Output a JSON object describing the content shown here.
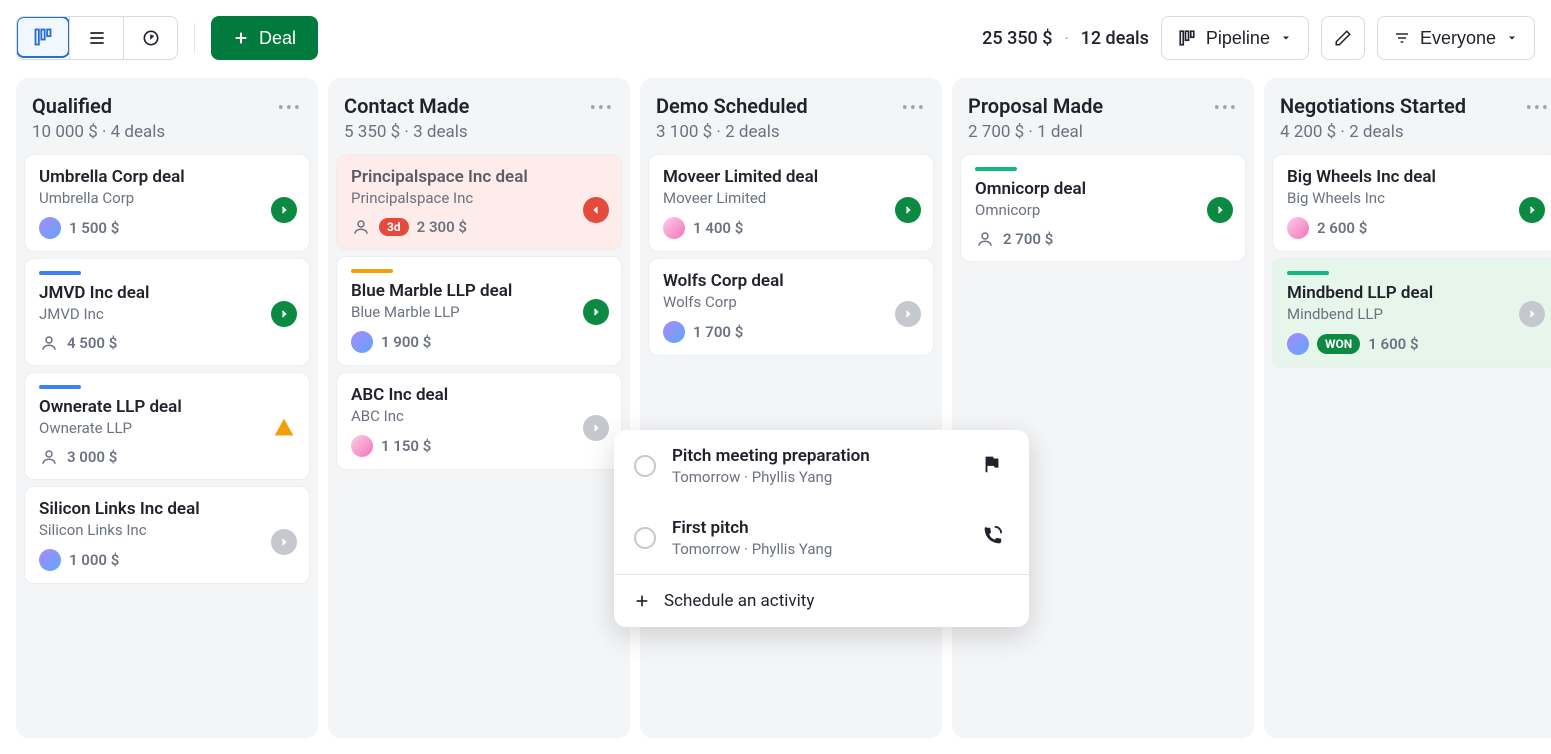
{
  "toolbar": {
    "deal_button": "Deal",
    "summary_amount": "25 350 $",
    "summary_count": "12 deals",
    "pipeline_label": "Pipeline",
    "everyone_label": "Everyone"
  },
  "columns": [
    {
      "title": "Qualified",
      "sub": "10 000 $ · 4 deals",
      "cards": [
        {
          "title": "Umbrella Corp deal",
          "subtitle": "Umbrella Corp",
          "amount": "1 500 $",
          "status": "green",
          "avatar": "a"
        },
        {
          "bar": "blue",
          "title": "JMVD Inc deal",
          "subtitle": "JMVD Inc",
          "amount": "4 500 $",
          "status": "green",
          "avatar": "outline"
        },
        {
          "bar": "blue",
          "title": "Ownerate LLP deal",
          "subtitle": "Ownerate LLP",
          "amount": "3 000 $",
          "status": "warn",
          "avatar": "outline"
        },
        {
          "title": "Silicon Links Inc deal",
          "subtitle": "Silicon Links Inc",
          "amount": "1 000 $",
          "status": "gray",
          "avatar": "a"
        }
      ]
    },
    {
      "title": "Contact Made",
      "sub": "5 350 $ · 3 deals",
      "cards": [
        {
          "bg": "red",
          "title": "Principalspace Inc deal",
          "subtitle": "Principalspace Inc",
          "amount": "2 300 $",
          "pill": "3d",
          "status": "red",
          "avatar": "outline"
        },
        {
          "bar": "orange",
          "title": "Blue Marble LLP deal",
          "subtitle": "Blue Marble LLP",
          "amount": "1 900 $",
          "status": "green",
          "avatar": "a"
        },
        {
          "title": "ABC Inc deal",
          "subtitle": "ABC Inc",
          "amount": "1 150 $",
          "status": "gray",
          "avatar": "p"
        }
      ]
    },
    {
      "title": "Demo Scheduled",
      "sub": "3 100 $ · 2 deals",
      "cards": [
        {
          "title": "Moveer Limited deal",
          "subtitle": "Moveer Limited",
          "amount": "1 400 $",
          "status": "green",
          "avatar": "p"
        },
        {
          "title": "Wolfs Corp deal",
          "subtitle": "Wolfs Corp",
          "amount": "1 700 $",
          "status": "gray",
          "avatar": "a"
        }
      ]
    },
    {
      "title": "Proposal Made",
      "sub": "2 700 $ · 1 deal",
      "cards": [
        {
          "bar": "green",
          "title": "Omnicorp deal",
          "subtitle": "Omnicorp",
          "amount": "2 700 $",
          "status": "green",
          "avatar": "outline"
        }
      ]
    },
    {
      "title": "Negotiations Started",
      "sub": "4 200 $ · 2 deals",
      "cards": [
        {
          "title": "Big Wheels Inc deal",
          "subtitle": "Big Wheels Inc",
          "amount": "2 600 $",
          "status": "green",
          "avatar": "p"
        },
        {
          "bg": "green",
          "bar": "green",
          "title": "Mindbend LLP deal",
          "subtitle": "Mindbend LLP",
          "amount": "1 600 $",
          "won": "WON",
          "status": "gray",
          "avatar": "a"
        }
      ]
    }
  ],
  "popover": {
    "items": [
      {
        "title": "Pitch meeting preparation",
        "sub": "Tomorrow · Phyllis Yang",
        "icon": "flag"
      },
      {
        "title": "First pitch",
        "sub": "Tomorrow · Phyllis Yang",
        "icon": "phone"
      }
    ],
    "footer": "Schedule an activity"
  }
}
